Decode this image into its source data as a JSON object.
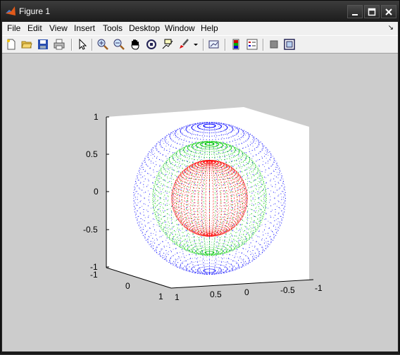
{
  "window": {
    "title": "Figure 1"
  },
  "menu": [
    "File",
    "Edit",
    "View",
    "Insert",
    "Tools",
    "Desktop",
    "Window",
    "Help"
  ],
  "toolbar": {
    "icons": [
      "new-figure-icon",
      "open-file-icon",
      "save-icon",
      "print-icon",
      "edit-plot-arrow-icon",
      "zoom-in-icon",
      "zoom-out-icon",
      "pan-hand-icon",
      "rotate-3d-icon",
      "data-cursor-icon",
      "brush-icon",
      "brush-dropdown-icon",
      "link-plot-icon",
      "colorbar-icon",
      "legend-icon",
      "hide-plot-tools-icon",
      "show-plot-tools-icon"
    ]
  },
  "axes": {
    "z_ticks": [
      "1",
      "0.5",
      "0",
      "-0.5",
      "-1"
    ],
    "x_ticks": [
      "-1",
      "0",
      "1"
    ],
    "y_ticks": [
      "1",
      "0.5",
      "0",
      "-0.5",
      "-1"
    ]
  },
  "spheres": [
    {
      "color": "#0000ff",
      "radius": 1.0
    },
    {
      "color": "#00cc00",
      "radius": 0.75
    },
    {
      "color": "#ff0000",
      "radius": 0.5
    }
  ]
}
